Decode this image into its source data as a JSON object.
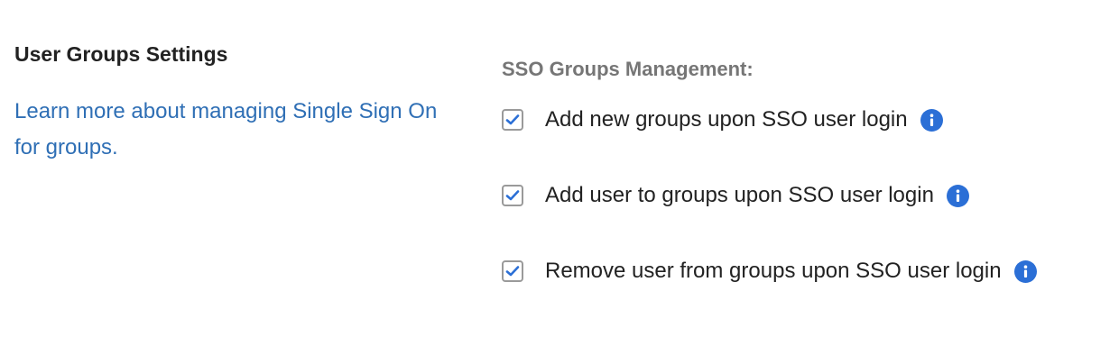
{
  "left": {
    "title": "User Groups Settings",
    "learn_more_link": "Learn more about managing Single Sign On for groups."
  },
  "right": {
    "heading": "SSO Groups Management:",
    "options": [
      {
        "label": "Add new groups upon SSO user login",
        "checked": true,
        "icon": "info-icon"
      },
      {
        "label": "Add user to groups upon SSO user login",
        "checked": true,
        "icon": "info-icon"
      },
      {
        "label": "Remove user from groups upon SSO user login",
        "checked": true,
        "icon": "info-icon"
      }
    ]
  },
  "colors": {
    "link": "#2f6fb5",
    "heading_gray": "#767676",
    "check_blue": "#2b6fd6",
    "info_blue": "#2b6fd6"
  }
}
